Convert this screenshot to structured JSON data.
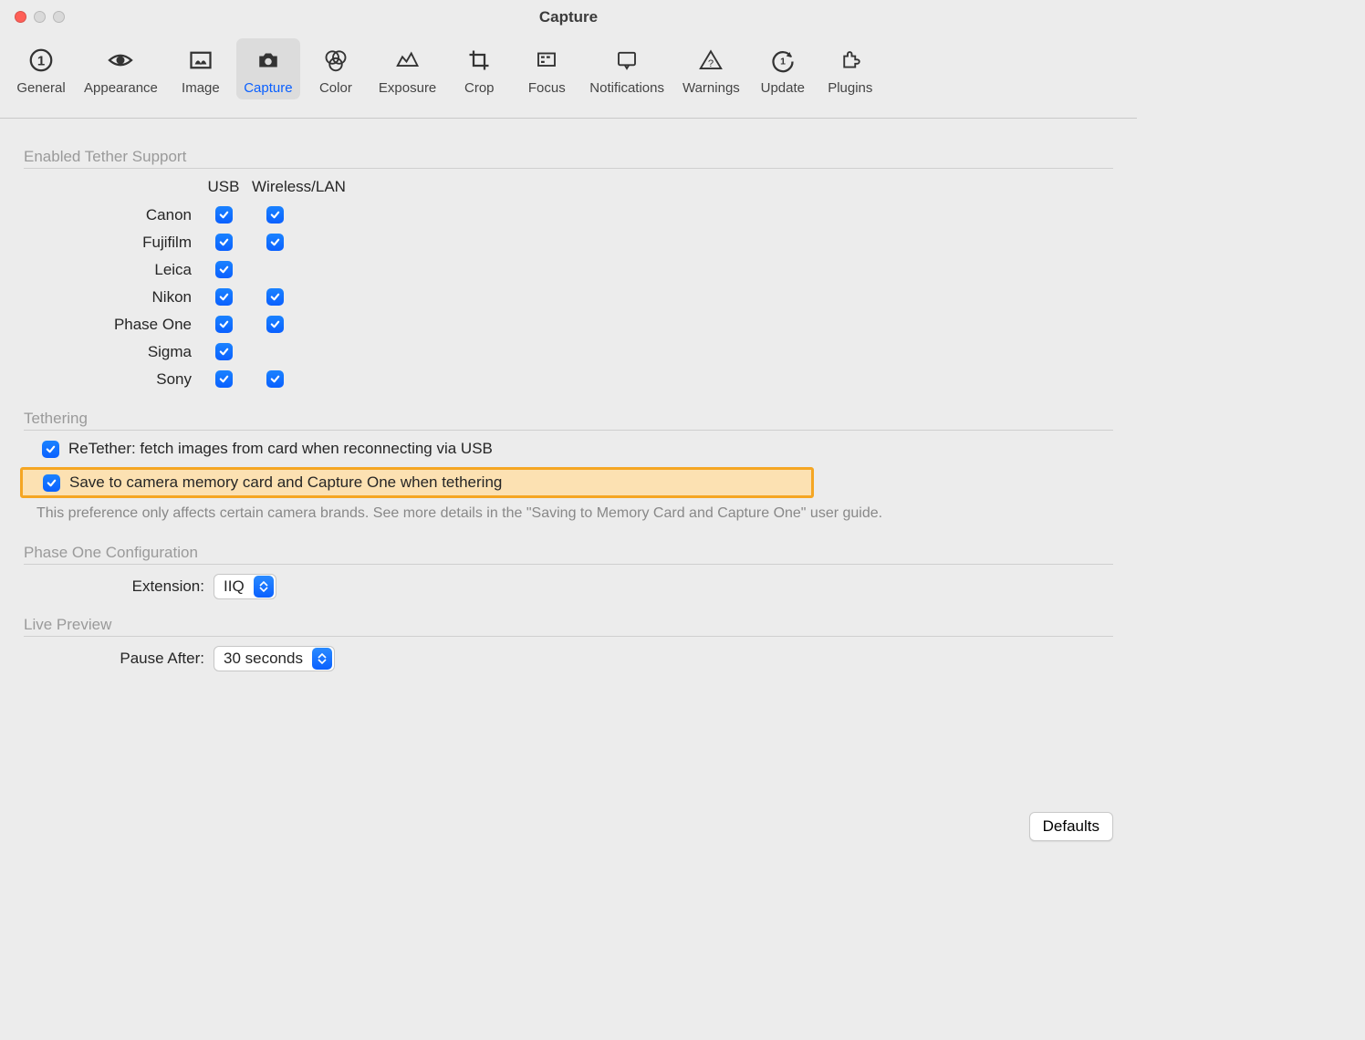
{
  "window": {
    "title": "Capture"
  },
  "tabs": [
    {
      "id": "general",
      "label": "General"
    },
    {
      "id": "appearance",
      "label": "Appearance"
    },
    {
      "id": "image",
      "label": "Image"
    },
    {
      "id": "capture",
      "label": "Capture"
    },
    {
      "id": "color",
      "label": "Color"
    },
    {
      "id": "exposure",
      "label": "Exposure"
    },
    {
      "id": "crop",
      "label": "Crop"
    },
    {
      "id": "focus",
      "label": "Focus"
    },
    {
      "id": "notifications",
      "label": "Notifications"
    },
    {
      "id": "warnings",
      "label": "Warnings"
    },
    {
      "id": "update",
      "label": "Update"
    },
    {
      "id": "plugins",
      "label": "Plugins"
    }
  ],
  "sections": {
    "tether_support": {
      "title": "Enabled Tether Support",
      "columns": {
        "usb": "USB",
        "wireless": "Wireless/LAN"
      },
      "rows": [
        {
          "brand": "Canon",
          "usb": true,
          "wireless": true
        },
        {
          "brand": "Fujifilm",
          "usb": true,
          "wireless": true
        },
        {
          "brand": "Leica",
          "usb": true,
          "wireless": false
        },
        {
          "brand": "Nikon",
          "usb": true,
          "wireless": true
        },
        {
          "brand": "Phase One",
          "usb": true,
          "wireless": true
        },
        {
          "brand": "Sigma",
          "usb": true,
          "wireless": false
        },
        {
          "brand": "Sony",
          "usb": true,
          "wireless": true
        }
      ]
    },
    "tethering": {
      "title": "Tethering",
      "retether": {
        "checked": true,
        "label": "ReTether: fetch images from card when reconnecting via USB"
      },
      "save_card": {
        "checked": true,
        "label": "Save to camera memory card and Capture One when tethering"
      },
      "note": "This preference only affects certain camera brands. See more details in the \"Saving to Memory Card and Capture One\" user guide."
    },
    "phase_one": {
      "title": "Phase One Configuration",
      "extension_label": "Extension:",
      "extension_value": "IIQ"
    },
    "live_preview": {
      "title": "Live Preview",
      "pause_label": "Pause After:",
      "pause_value": "30 seconds"
    }
  },
  "defaults_button": "Defaults"
}
